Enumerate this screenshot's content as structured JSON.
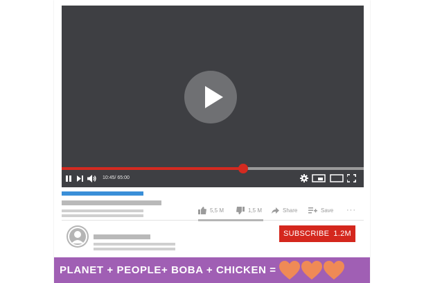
{
  "player": {
    "time_display": "10:45/ 65:00",
    "progress_fraction": 0.6,
    "controls": [
      "pause-icon",
      "next-icon",
      "volume-icon",
      "gear-icon",
      "miniplayer-icon",
      "theater-icon",
      "fullscreen-icon"
    ]
  },
  "actions": {
    "likes": "5,5 M",
    "dislikes": "1,5 M",
    "share_label": "Share",
    "save_label": "Save",
    "more_label": "···"
  },
  "channel": {
    "subscribe_label": "SUBSCRIBE",
    "subscriber_count": "1.2M"
  },
  "banner": {
    "text": "PLANET + PEOPLE+ BOBA + CHICKEN =",
    "heart_count": 3
  },
  "colors": {
    "accent_red": "#d42a20",
    "link_blue": "#3a8fd8",
    "banner_purple": "#a05fb4",
    "heart_orange": "#ef8a56",
    "video_bg": "#3e3f43"
  }
}
